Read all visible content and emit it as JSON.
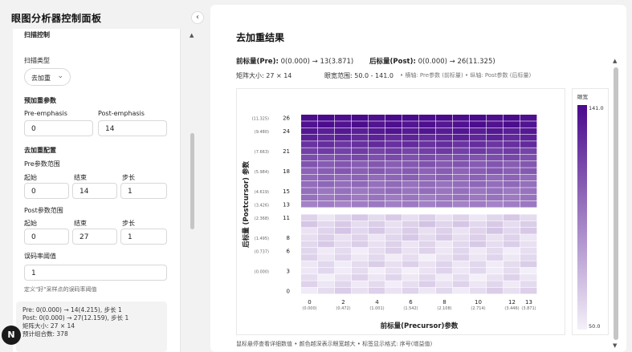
{
  "sidebar": {
    "title": "眼图分析器控制面板",
    "collapse_icon": "‹",
    "scan_control_heading": "扫描控制",
    "scan_type_label": "扫描类型",
    "scan_type_value": "去加重",
    "preemph_heading": "预加重参数",
    "pre_label": "Pre-emphasis",
    "pre_value": "0",
    "post_label": "Post-emphasis",
    "post_value": "14",
    "deemph_heading": "去加重配置",
    "pre_range_label": "Pre参数范围",
    "start_label": "起始",
    "end_label": "结束",
    "step_label": "步长",
    "pre_start": "0",
    "pre_end": "14",
    "pre_step": "1",
    "post_range_label": "Post参数范围",
    "post_start": "0",
    "post_end": "27",
    "post_step": "1",
    "ber_label": "误码率阈值",
    "ber_value": "1",
    "ber_hint": "定义\"好\"采样点的误码率阈值",
    "summary": [
      "Pre: 0(0.000) → 14(4.215), 步长 1",
      "Post: 0(0.000) → 27(12.159), 步长 1",
      "矩阵大小: 27 × 14",
      "预计组合数: 378"
    ],
    "logo_letter": "N"
  },
  "main": {
    "title": "去加重结果",
    "pre_label": "前标量(Pre):",
    "pre_range": "0(0.000) → 13(3.871)",
    "post_label": "后标量(Post):",
    "post_range": "0(0.000) → 26(11.325)",
    "matrix_label": "矩阵大小:",
    "matrix_value": "27 × 14",
    "eye_label": "眼宽范围:",
    "eye_value": "50.0 - 141.0",
    "axis_hint": "• 横轴: Pre参数 (前标量) • 纵轴: Post参数 (后标量)",
    "footer": "鼠标悬停查看详细数值 • 颜色越深表示眼宽越大 • 标签显示格式: 序号(增益值)"
  },
  "colors": {
    "accent": "#4a0a8c",
    "low": "#f4f0f9",
    "high": "#4a0a8c"
  },
  "chart_data": {
    "type": "heatmap",
    "xlabel": "前标量(Precursor)参数",
    "ylabel": "后标量 (Postcursor) 参数",
    "colorbar_title": "眼宽",
    "colorbar_max_label": "141.0",
    "colorbar_min_label": "50.0",
    "vmin": 50.0,
    "vmax": 141.0,
    "x_indices": [
      0,
      1,
      2,
      3,
      4,
      5,
      6,
      7,
      8,
      9,
      10,
      11,
      12,
      13
    ],
    "x_ticks": [
      {
        "idx": 0,
        "label": "0",
        "gain": "(0.000)"
      },
      {
        "idx": 2,
        "label": "2",
        "gain": "(0.472)"
      },
      {
        "idx": 4,
        "label": "4",
        "gain": "(1.001)"
      },
      {
        "idx": 6,
        "label": "6",
        "gain": "(1.542)"
      },
      {
        "idx": 8,
        "label": "8",
        "gain": "(2.108)"
      },
      {
        "idx": 10,
        "label": "10",
        "gain": "(2.714)"
      },
      {
        "idx": 12,
        "label": "12",
        "gain": "(3.446)"
      },
      {
        "idx": 13,
        "label": "13",
        "gain": "(3.871)"
      }
    ],
    "y_ticks": [
      {
        "idx": 26,
        "label": "26",
        "gain": "(11.325)"
      },
      {
        "idx": 24,
        "label": "24",
        "gain": "(9.480)"
      },
      {
        "idx": 21,
        "label": "21",
        "gain": "(7.663)"
      },
      {
        "idx": 18,
        "label": "18",
        "gain": "(5.984)"
      },
      {
        "idx": 15,
        "label": "15",
        "gain": "(4.619)"
      },
      {
        "idx": 13,
        "label": "13",
        "gain": "(3.426)"
      },
      {
        "idx": 11,
        "label": "11",
        "gain": "(2.368)"
      },
      {
        "idx": 8,
        "label": "8",
        "gain": "(1.495)"
      },
      {
        "idx": 6,
        "label": "6",
        "gain": "(0.737)"
      },
      {
        "idx": 3,
        "label": "3",
        "gain": "(0.000)"
      },
      {
        "idx": 0,
        "label": "0",
        "gain": ""
      }
    ],
    "row_profile": {
      "0": 58,
      "1": 57,
      "2": 56,
      "3": 55,
      "4": 58,
      "5": 56,
      "6": 57,
      "7": 59,
      "8": 60,
      "9": 61,
      "10": 62,
      "11": 60,
      "12": null,
      "13": 95,
      "14": 98,
      "15": 100,
      "16": 102,
      "17": 105,
      "18": 108,
      "19": 110,
      "20": 114,
      "21": 120,
      "22": 126,
      "23": 130,
      "24": 135,
      "25": 138,
      "26": 141
    }
  }
}
